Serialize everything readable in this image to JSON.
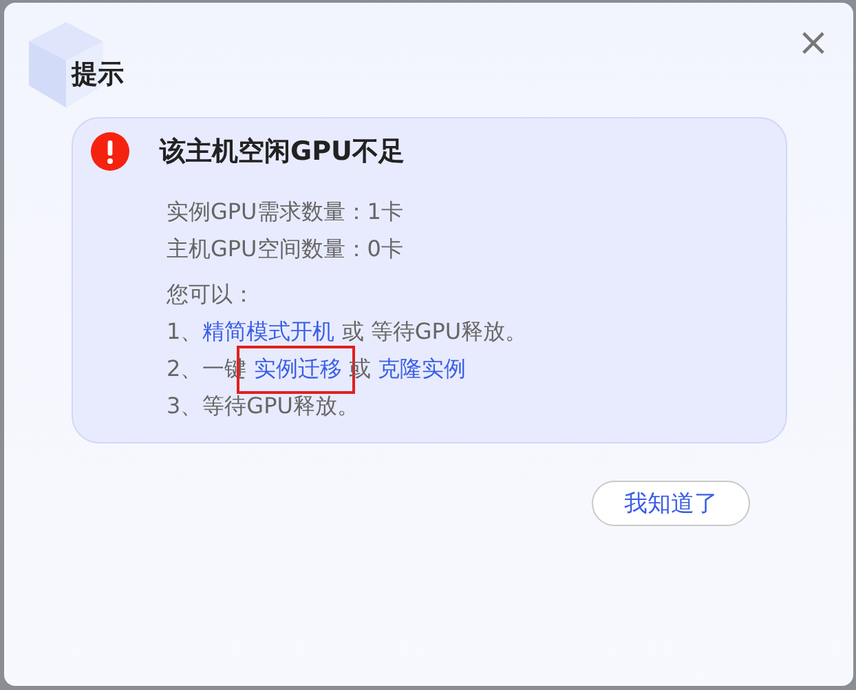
{
  "dialog": {
    "title": "提示",
    "close": "×",
    "alert": {
      "heading": "该主机空闲GPU不足",
      "facts": [
        "实例GPU需求数量：1卡",
        "主机GPU空间数量：0卡"
      ],
      "intro": "您可以：",
      "options": [
        [
          {
            "kind": "text",
            "text": "1、"
          },
          {
            "kind": "link",
            "text": "精简模式开机",
            "highlighted": false
          },
          {
            "kind": "text",
            "text": " 或 等待GPU释放。"
          }
        ],
        [
          {
            "kind": "text",
            "text": "2、一键 "
          },
          {
            "kind": "link",
            "text": "实例迁移",
            "highlighted": true
          },
          {
            "kind": "text",
            "text": " 或 "
          },
          {
            "kind": "link",
            "text": "克隆实例",
            "highlighted": false
          }
        ],
        [
          {
            "kind": "text",
            "text": "3、等待GPU释放。"
          }
        ]
      ]
    },
    "button": "我知道了"
  }
}
